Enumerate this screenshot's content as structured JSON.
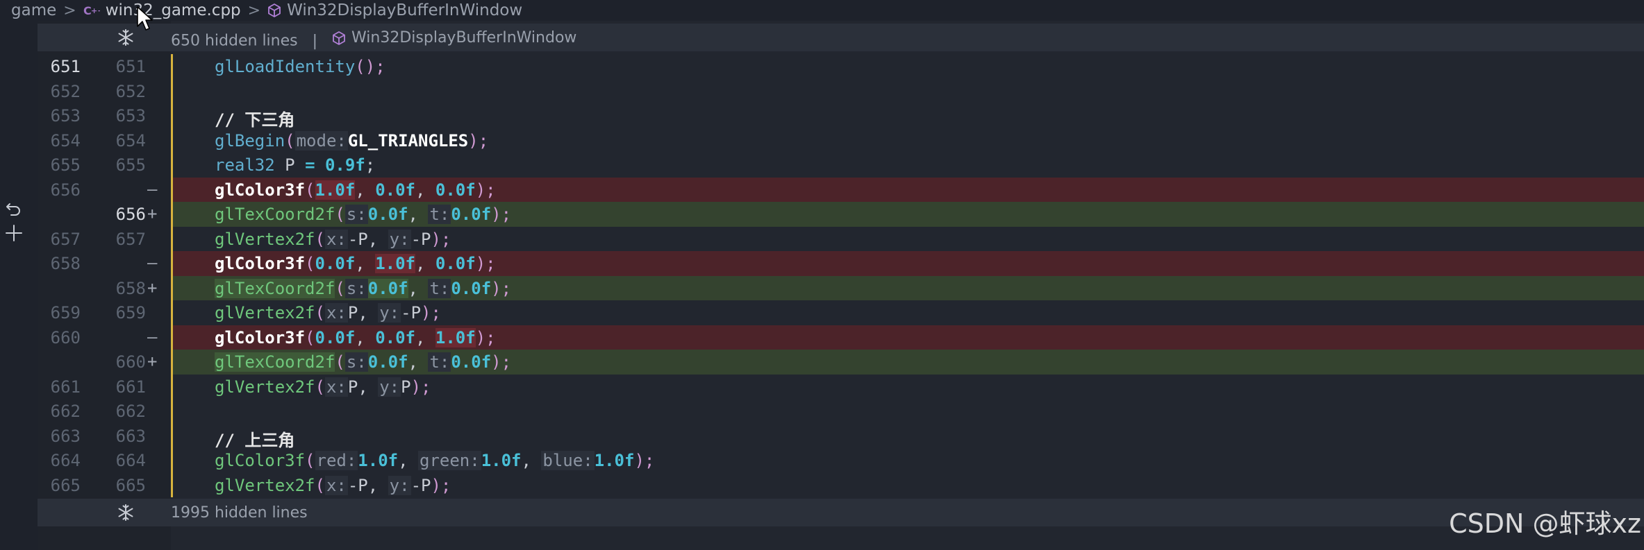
{
  "breadcrumb": {
    "items": [
      {
        "label": "game",
        "icon": "none"
      },
      {
        "label": "win32_game.cpp",
        "icon": "cpp-file-icon"
      },
      {
        "label": "Win32DisplayBufferInWindow",
        "icon": "symbol-method-icon"
      }
    ],
    "separator": ">"
  },
  "folds": {
    "top": {
      "text": "650 hidden lines",
      "divider": "|",
      "context": "Win32DisplayBufferInWindow"
    },
    "bottom": {
      "text": "1995 hidden lines"
    }
  },
  "diff_markers": {
    "removed": "—",
    "added": "+"
  },
  "lines": [
    {
      "old": "651",
      "new": "651",
      "type": "context",
      "active": true
    },
    {
      "old": "652",
      "new": "652",
      "type": "context"
    },
    {
      "old": "653",
      "new": "653",
      "type": "context"
    },
    {
      "old": "654",
      "new": "654",
      "type": "context"
    },
    {
      "old": "655",
      "new": "655",
      "type": "context"
    },
    {
      "old": "656",
      "new": "",
      "type": "removed"
    },
    {
      "old": "",
      "new": "656",
      "type": "added",
      "active": true
    },
    {
      "old": "657",
      "new": "657",
      "type": "context"
    },
    {
      "old": "658",
      "new": "",
      "type": "removed"
    },
    {
      "old": "",
      "new": "658",
      "type": "added"
    },
    {
      "old": "659",
      "new": "659",
      "type": "context"
    },
    {
      "old": "660",
      "new": "",
      "type": "removed"
    },
    {
      "old": "",
      "new": "660",
      "type": "added"
    },
    {
      "old": "661",
      "new": "661",
      "type": "context"
    },
    {
      "old": "662",
      "new": "662",
      "type": "context"
    },
    {
      "old": "663",
      "new": "663",
      "type": "context"
    },
    {
      "old": "664",
      "new": "664",
      "type": "context"
    },
    {
      "old": "665",
      "new": "665",
      "type": "context"
    }
  ],
  "code": {
    "l651": {
      "fn": "glLoadIdentity",
      "rest": "();"
    },
    "l653": {
      "comment": "// 下三角"
    },
    "l654": {
      "fn": "glBegin",
      "hint": "mode:",
      "arg": "GL_TRIANGLES",
      "close": ");"
    },
    "l655": {
      "type": "real32",
      "name": "P",
      "op": "=",
      "val": "0.9f",
      "semi": ";"
    },
    "l656r": {
      "fn": "glColor3f",
      "a1": "1.0f",
      "a2": "0.0f",
      "a3": "0.0f"
    },
    "l656a": {
      "fn": "glTexCoord2f",
      "h1": "s:",
      "a1": "0.0f",
      "h2": "t:",
      "a2": "0.0f"
    },
    "l657": {
      "fn": "glVertex2f",
      "h1": "x:",
      "a1": "-P",
      "h2": "y:",
      "a2": "-P"
    },
    "l658r": {
      "fn": "glColor3f",
      "a1": "0.0f",
      "a2": "1.0f",
      "a3": "0.0f"
    },
    "l658a": {
      "fn": "glTexCoord2f",
      "h1": "s:",
      "a1": "0.0f",
      "h2": "t:",
      "a2": "0.0f"
    },
    "l659": {
      "fn": "glVertex2f",
      "h1": "x:",
      "a1": "P",
      "h2": "y:",
      "a2": "-P"
    },
    "l660r": {
      "fn": "glColor3f",
      "a1": "0.0f",
      "a2": "0.0f",
      "a3": "1.0f"
    },
    "l660a": {
      "fn": "glTexCoord2f",
      "h1": "s:",
      "a1": "0.0f",
      "h2": "t:",
      "a2": "0.0f"
    },
    "l661": {
      "fn": "glVertex2f",
      "h1": "x:",
      "a1": "P",
      "h2": "y:",
      "a2": "P"
    },
    "l663": {
      "comment": "// 上三角"
    },
    "l664": {
      "fn": "glColor3f",
      "h1": "red:",
      "a1": "1.0f",
      "h2": "green:",
      "a2": "1.0f",
      "h3": "blue:",
      "a3": "1.0f"
    },
    "l665": {
      "fn": "glVertex2f",
      "h1": "x:",
      "a1": "-P",
      "h2": "y:",
      "a2": "-P"
    }
  },
  "watermark": "CSDN @虾球xz",
  "colors": {
    "background": "#22262f",
    "removed": "#4c2329",
    "added": "#34432f",
    "changeBar": "#d7b33e"
  }
}
